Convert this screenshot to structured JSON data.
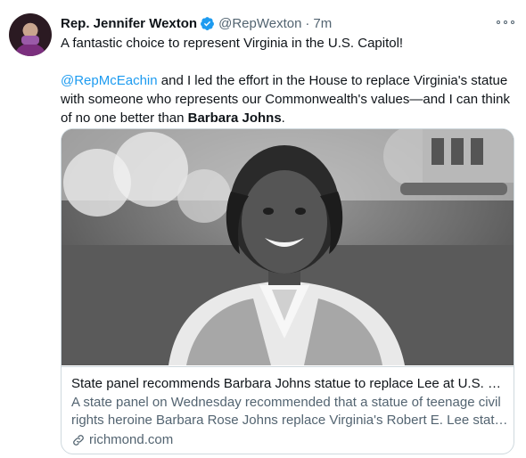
{
  "author": {
    "name": "Rep. Jennifer Wexton",
    "handle": "@RepWexton",
    "separator": "·",
    "time": "7m",
    "verified_icon": "verified-badge-icon",
    "avatar_icon": "profile-photo"
  },
  "tweet": {
    "line1": "A fantastic choice to represent Virginia in the U.S. Capitol!",
    "mention": "@RepMcEachin",
    "line2_rest": " and I led the effort in the House to replace Virginia's statue",
    "line3": "with someone who represents our Commonwealth's values—and I can think",
    "line4_start": "of no one better than ",
    "line4_bold": "Barbara Johns",
    "line4_end": "."
  },
  "card": {
    "title": "State panel recommends Barbara Johns statue to replace Lee at U.S. Capitol",
    "description_line1": "A state panel on Wednesday recommended that a statue of teenage civil",
    "description_line2": "rights heroine Barbara Rose Johns replace Virginia's Robert E. Lee statue in the U.S. Capitol",
    "domain": "richmond.com",
    "domain_icon": "link-icon"
  },
  "colors": {
    "accent": "#1d9bf0",
    "text_primary": "#0f1419",
    "text_secondary": "#536471",
    "border": "#cfd9de"
  }
}
